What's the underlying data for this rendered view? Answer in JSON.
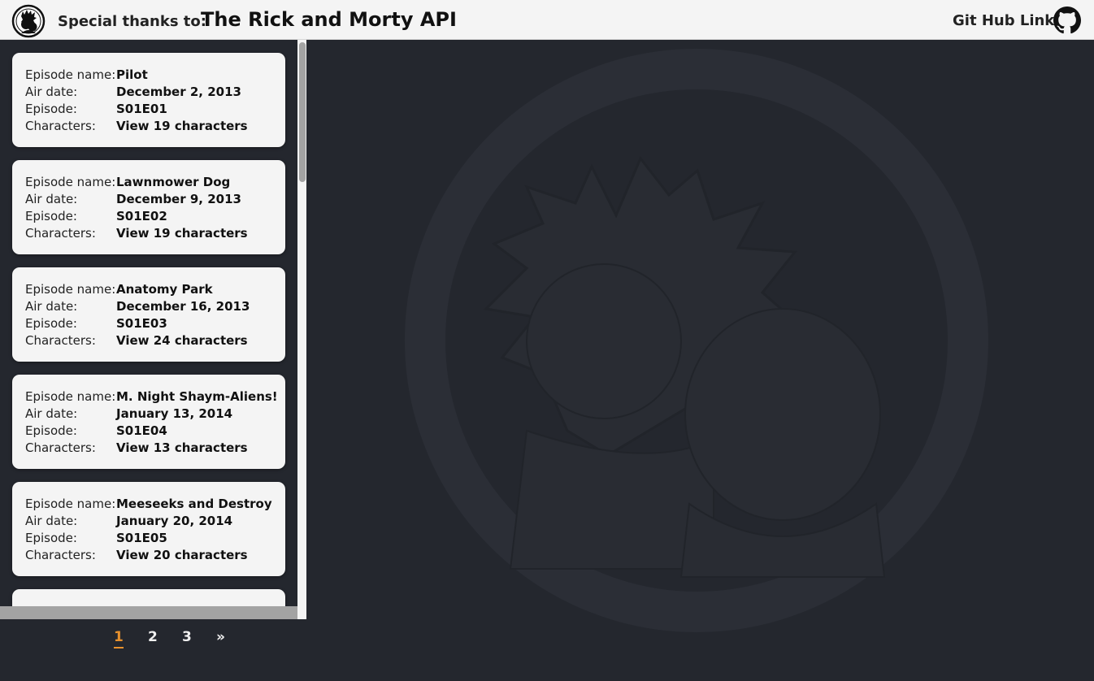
{
  "header": {
    "thanks_label": "Special thanks to:",
    "api_title": "The Rick and Morty API",
    "github_link": "Git Hub Link"
  },
  "field_labels": {
    "name": "Episode name:",
    "air_date": "Air date:",
    "episode": "Episode:",
    "characters": "Characters:"
  },
  "episodes": [
    {
      "name": "Pilot",
      "air_date": "December 2, 2013",
      "episode": "S01E01",
      "characters": "View 19 characters"
    },
    {
      "name": "Lawnmower Dog",
      "air_date": "December 9, 2013",
      "episode": "S01E02",
      "characters": "View 19 characters"
    },
    {
      "name": "Anatomy Park",
      "air_date": "December 16, 2013",
      "episode": "S01E03",
      "characters": "View 24 characters"
    },
    {
      "name": "M. Night Shaym-Aliens!",
      "air_date": "January 13, 2014",
      "episode": "S01E04",
      "characters": "View 13 characters"
    },
    {
      "name": "Meeseeks and Destroy",
      "air_date": "January 20, 2014",
      "episode": "S01E05",
      "characters": "View 20 characters"
    }
  ],
  "pagination": {
    "pages": [
      "1",
      "2",
      "3"
    ],
    "next": "»",
    "current": "1"
  },
  "colors": {
    "background": "#24272e",
    "header_bg": "#f4f4f4",
    "card_bg": "#f4f4f4",
    "active_page": "#e8912d"
  }
}
